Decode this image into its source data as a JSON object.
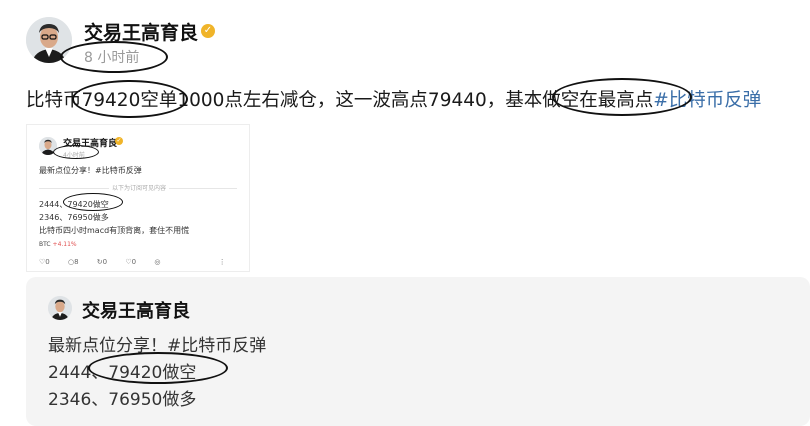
{
  "post": {
    "author": "交易王高育良",
    "time": "8 小时前",
    "text_main": "比特币79420空单1000点左右减仓，这一波高点79440，基本做空在最高点",
    "hashtag": "#比特币反弹"
  },
  "embedded_screenshot": {
    "author": "交易王高育良",
    "time": "4小时前",
    "line1": "最新点位分享！#比特币反弹",
    "divider_label": "以下为订阅可见内容",
    "line2": "2444、79420做空",
    "line3": "2346、76950做多",
    "line4": "比特币四小时macd有顶背离，套住不用慌",
    "btc_label": "BTC",
    "btc_change": "+4.11%",
    "actions": {
      "comment_count": "0",
      "repost_count": "8",
      "like_count": "0",
      "share_count": "0"
    }
  },
  "quote": {
    "author": "交易王高育良",
    "line1": "最新点位分享！#比特币反弹",
    "line2": "2444、79420做空",
    "line3": "2346、76950做多"
  }
}
